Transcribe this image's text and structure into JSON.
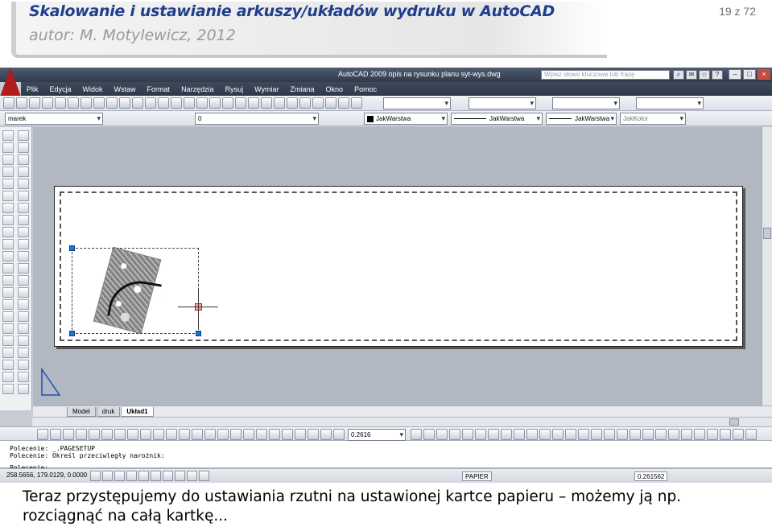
{
  "slide": {
    "title": "Skalowanie i ustawianie arkuszy/układów wydruku w AutoCAD",
    "author": "autor: M. Motylewicz, 2012",
    "page": "19 z 72",
    "caption_line1": "Teraz przystępujemy do ustawiania rzutni na ustawionej kartce papieru – możemy ją np.",
    "caption_line2": "rozciągnąć na całą kartkę..."
  },
  "window": {
    "title": "AutoCAD 2009 opis na rysunku planu syt-wys.dwg",
    "search_placeholder": "Wpisz słowo kluczowe lub frazę",
    "logo_icon": "autocad-logo-icon"
  },
  "menu": [
    "Plik",
    "Edycja",
    "Widok",
    "Wstaw",
    "Format",
    "Narzędzia",
    "Rysuj",
    "Wymiar",
    "Zmiana",
    "Okno",
    "Pomoc"
  ],
  "layers": {
    "current_layer": "marek",
    "layer_dropdown": "0",
    "color": "JakWarstwa",
    "linetype": "JakWarstwa",
    "lineweight": "JakWarstwa",
    "plotstyle": "JakKolor"
  },
  "tabs": [
    {
      "label": "Model",
      "active": false
    },
    {
      "label": "druk",
      "active": false
    },
    {
      "label": "Układ1",
      "active": true
    }
  ],
  "dimension_toolbar": {
    "value": "0.2616"
  },
  "command_line": [
    "Polecenie: _.PAGESETUP",
    "Polecenie: Określ przeciwległy narożnik:",
    "Polecenie:"
  ],
  "status": {
    "coordinates": "258.5656, 179.0129, 0.0000",
    "paper_label": "PAPIER",
    "scale": "0.261562"
  },
  "colors": {
    "title_blue": "#1f3e8c",
    "grip_blue": "#1e74d6",
    "crosshair_red": "#b01b1b",
    "canvas_gray": "#b2b8c2"
  }
}
